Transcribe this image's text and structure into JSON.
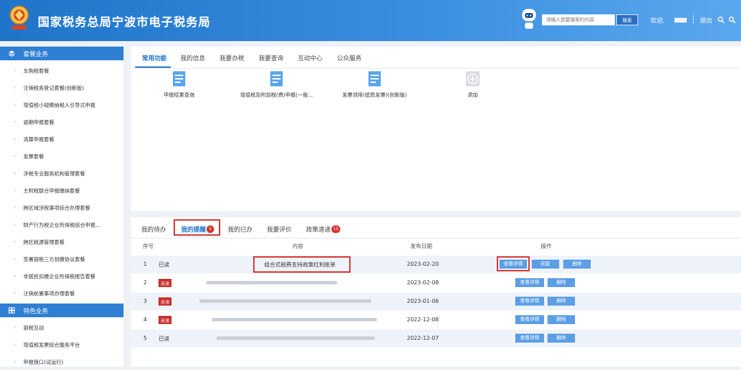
{
  "header": {
    "title": "国家税务总局宁波市电子税务局",
    "search_placeholder": "请输入想要搜索的内容",
    "search_button": "搜索",
    "welcome": "欢迎,",
    "logout": "退出",
    "colors": {
      "header_blue": "#1f74c9",
      "accent_red": "#d7322f"
    }
  },
  "sidebar": {
    "groups": [
      {
        "title": "套餐业务",
        "items": [
          "车购税套餐",
          "注销税务登记套餐(创新版)",
          "增值税小规模纳税人引导式申报",
          "逾期申报套餐",
          "清算申报套餐",
          "发票套餐",
          "涉税专业服务机构管理套餐",
          "主附税联合申报缴纳套餐",
          "跨区域涉税事项综合办理套餐",
          "财产行为税企业所得税综合申报...",
          "跨区税源管理套餐",
          "签署银税三方划缴协议套餐",
          "非居民扣缴企业所得税报告套餐",
          "注销前置事项办理套餐"
        ]
      },
      {
        "title": "特色业务",
        "items": [
          "银税互动",
          "增值税发票综合服务平台",
          "申报接口(试运行)"
        ]
      }
    ]
  },
  "top_tabs": [
    "常用功能",
    "我的信息",
    "我要办税",
    "我要查询",
    "互动中心",
    "公众服务"
  ],
  "functions": [
    {
      "label": "申报结果查询",
      "icon": "document-icon"
    },
    {
      "label": "增值税及附加税(费)申报(一般...",
      "icon": "document-icon"
    },
    {
      "label": "发票领用(纸质发票)(创新版)",
      "icon": "document-icon"
    },
    {
      "label": "添加",
      "icon": "plus-circle-icon"
    }
  ],
  "bottom_tabs": [
    {
      "label": "我的待办"
    },
    {
      "label": "我的提醒",
      "badge": "5"
    },
    {
      "label": "我的已办"
    },
    {
      "label": "我要评价"
    },
    {
      "label": "政策速递",
      "badge": "15"
    }
  ],
  "table": {
    "headers": [
      "序号",
      "内容",
      "发布日期",
      "操作"
    ],
    "rows": [
      {
        "no": "1",
        "status": "已读",
        "content": "组合式税费支持政策红利账单",
        "date": "2023-02-20",
        "actions": [
          "查看详情",
          "回复",
          "删除"
        ]
      },
      {
        "no": "2",
        "status": "未读",
        "content": "",
        "date": "2023-02-08",
        "actions": [
          "查看详情",
          "删除"
        ]
      },
      {
        "no": "3",
        "status": "未读",
        "content": "",
        "date": "2023-01-06",
        "actions": [
          "查看详情",
          "删除"
        ]
      },
      {
        "no": "4",
        "status": "未读",
        "content": "",
        "date": "2022-12-08",
        "actions": [
          "查看详情",
          "删除"
        ]
      },
      {
        "no": "5",
        "status": "已读",
        "content": "",
        "date": "2022-12-07",
        "actions": [
          "查看详情",
          "删除"
        ]
      }
    ]
  }
}
